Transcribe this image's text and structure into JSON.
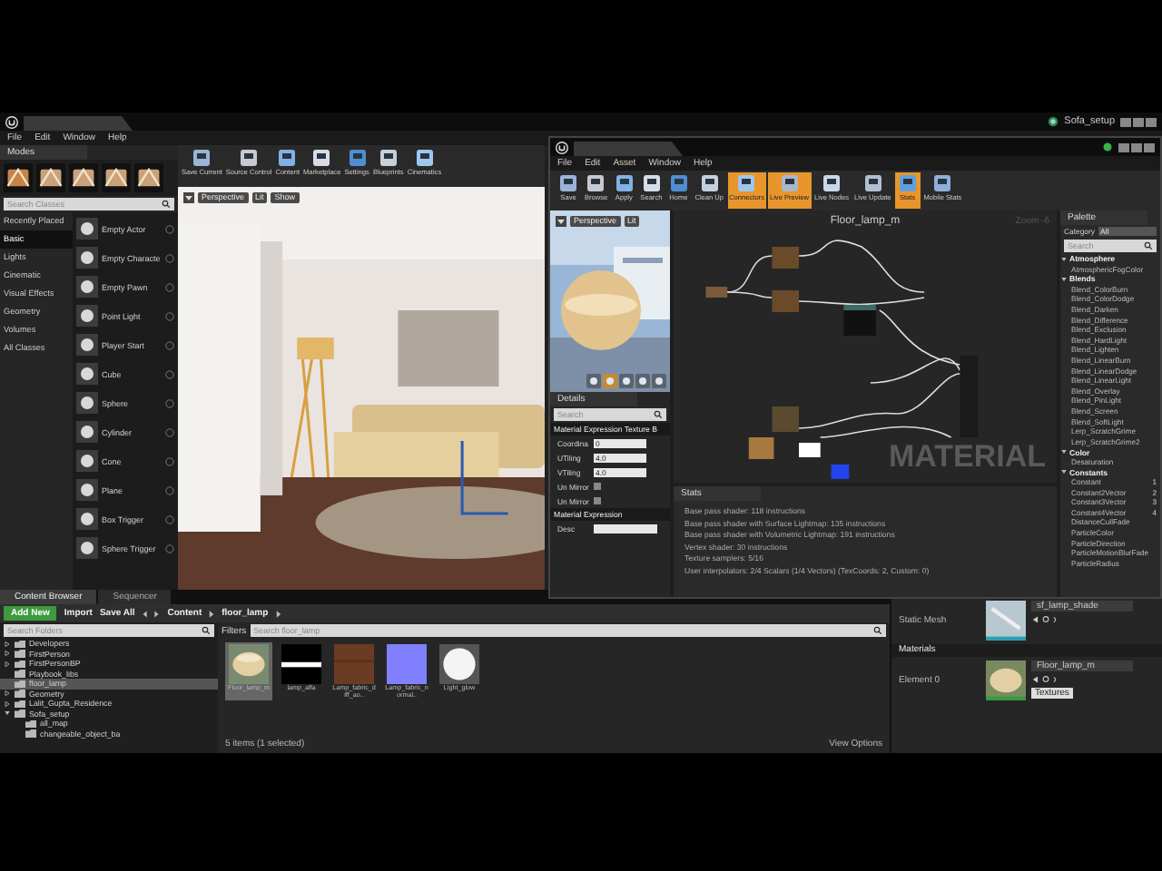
{
  "main_window": {
    "title": "Sofa_setup",
    "menu": [
      "File",
      "Edit",
      "Window",
      "Help"
    ]
  },
  "modes": {
    "title": "Modes",
    "search_placeholder": "Search Classes",
    "categories": [
      {
        "label": "Recently Placed",
        "selected": false
      },
      {
        "label": "Basic",
        "selected": true
      },
      {
        "label": "Lights",
        "selected": false
      },
      {
        "label": "Cinematic",
        "selected": false
      },
      {
        "label": "Visual Effects",
        "selected": false
      },
      {
        "label": "Geometry",
        "selected": false
      },
      {
        "label": "Volumes",
        "selected": false
      },
      {
        "label": "All Classes",
        "selected": false
      }
    ],
    "items": [
      "Empty Actor",
      "Empty Characte",
      "Empty Pawn",
      "Point Light",
      "Player Start",
      "Cube",
      "Sphere",
      "Cylinder",
      "Cone",
      "Plane",
      "Box Trigger",
      "Sphere Trigger"
    ]
  },
  "toolbar": [
    "Save Current",
    "Source Control",
    "Content",
    "Marketplace",
    "Settings",
    "Blueprints",
    "Cinematics"
  ],
  "viewport": {
    "buttons": [
      "Perspective",
      "Lit",
      "Show"
    ]
  },
  "material_editor": {
    "menu": [
      "File",
      "Edit",
      "Asset",
      "Window",
      "Help"
    ],
    "toolbar": [
      {
        "label": "Save",
        "selected": false
      },
      {
        "label": "Browse",
        "selected": false
      },
      {
        "label": "Apply",
        "selected": false
      },
      {
        "label": "Search",
        "selected": false
      },
      {
        "label": "Home",
        "selected": false
      },
      {
        "label": "Clean Up",
        "selected": false
      },
      {
        "label": "Connectors",
        "selected": true
      },
      {
        "label": "Live Preview",
        "selected": true
      },
      {
        "label": "Live Nodes",
        "selected": false
      },
      {
        "label": "Live Update",
        "selected": false
      },
      {
        "label": "Stats",
        "selected": true
      },
      {
        "label": "Mobile Stats",
        "selected": false
      }
    ],
    "preview_buttons": [
      "Perspective",
      "Lit"
    ],
    "graph": {
      "title": "Floor_lamp_m",
      "zoom": "Zoom -6",
      "watermark": "MATERIAL"
    },
    "details": {
      "title": "Details",
      "search_placeholder": "Search",
      "sections": [
        {
          "title": "Material Expression Texture B",
          "props": [
            {
              "kind": "number",
              "label": "Coordina",
              "value": "0"
            },
            {
              "kind": "number",
              "label": "UTiling",
              "value": "4.0"
            },
            {
              "kind": "number",
              "label": "VTiling",
              "value": "4.0"
            },
            {
              "kind": "checkbox",
              "label": "Un Mirror",
              "checked": false
            },
            {
              "kind": "checkbox",
              "label": "Un Mirror",
              "checked": false
            }
          ]
        },
        {
          "title": "Material Expression",
          "props": [
            {
              "kind": "text",
              "label": "Desc"
            }
          ]
        }
      ]
    },
    "stats": {
      "tab": "Stats",
      "lines": [
        "Base pass shader: 118 instructions",
        "Base pass shader with Surface Lightmap: 135 instructions",
        "Base pass shader with Volumetric Lightmap: 191 instructions",
        "Vertex shader: 30 instructions",
        "Texture samplers: 5/16",
        "User interpolators: 2/4 Scalars (1/4 Vectors) (TexCoords: 2, Custom: 0)"
      ]
    },
    "palette": {
      "title": "Palette",
      "category_label": "Category",
      "category": "All",
      "search_placeholder": "Search",
      "groups": [
        {
          "name": "Atmosphere",
          "expanded": true,
          "items": [
            {
              "name": "AtmosphericFogColor"
            }
          ]
        },
        {
          "name": "Blends",
          "expanded": true,
          "items": [
            {
              "name": "Blend_ColorBurn"
            },
            {
              "name": "Blend_ColorDodge"
            },
            {
              "name": "Blend_Darken"
            },
            {
              "name": "Blend_Difference"
            },
            {
              "name": "Blend_Exclusion"
            },
            {
              "name": "Blend_HardLight"
            },
            {
              "name": "Blend_Lighten"
            },
            {
              "name": "Blend_LinearBurn"
            },
            {
              "name": "Blend_LinearDodge"
            },
            {
              "name": "Blend_LinearLight"
            },
            {
              "name": "Blend_Overlay"
            },
            {
              "name": "Blend_PinLight"
            },
            {
              "name": "Blend_Screen"
            },
            {
              "name": "Blend_SoftLight"
            },
            {
              "name": "Lerp_ScratchGrime"
            },
            {
              "name": "Lerp_ScratchGrime2"
            }
          ]
        },
        {
          "name": "Color",
          "expanded": true,
          "items": [
            {
              "name": "Desaturation"
            }
          ]
        },
        {
          "name": "Constants",
          "expanded": true,
          "items": [
            {
              "name": "Constant",
              "hotkey": "1"
            },
            {
              "name": "Constant2Vector",
              "hotkey": "2"
            },
            {
              "name": "Constant3Vector",
              "hotkey": "3"
            },
            {
              "name": "Constant4Vector",
              "hotkey": "4"
            },
            {
              "name": "DistanceCullFade"
            },
            {
              "name": "ParticleColor"
            },
            {
              "name": "ParticleDirection"
            },
            {
              "name": "ParticleMotionBlurFade"
            },
            {
              "name": "ParticleRadius"
            }
          ]
        }
      ]
    }
  },
  "content_browser": {
    "tabs": [
      {
        "label": "Content Browser",
        "selected": true
      },
      {
        "label": "Sequencer",
        "selected": false
      }
    ],
    "add_new": "Add New",
    "import": "Import",
    "save_all": "Save All",
    "path": [
      "Content",
      "floor_lamp"
    ],
    "folder_search_placeholder": "Search Folders",
    "folders": [
      {
        "name": "Developers",
        "expanded": false,
        "selected": false
      },
      {
        "name": "FirstPerson",
        "expanded": false,
        "selected": false
      },
      {
        "name": "FirstPersonBP",
        "expanded": false,
        "selected": false
      },
      {
        "name": "Playbook_libs",
        "selected": false
      },
      {
        "name": "floor_lamp",
        "selected": true
      },
      {
        "name": "Geometry",
        "expanded": false,
        "selected": false
      },
      {
        "name": "Lalit_Gupta_Residence",
        "expanded": false,
        "selected": false
      },
      {
        "name": "Sofa_setup",
        "expanded": true,
        "selected": false,
        "children": [
          {
            "name": "all_map",
            "selected": false
          },
          {
            "name": "changeable_object_ba",
            "selected": false
          }
        ]
      }
    ],
    "filters": "Filters",
    "search_placeholder": "Search floor_lamp",
    "assets": [
      {
        "name": "Floor_lamp_m",
        "selected": true
      },
      {
        "name": "lamp_alfa",
        "selected": false
      },
      {
        "name": "Lamp_fabric_diff_ao..",
        "selected": false
      },
      {
        "name": "Lamp_fabric_normal..",
        "selected": false
      },
      {
        "name": "Light_glow",
        "selected": false
      }
    ],
    "count": "5 items (1 selected)",
    "view_options": "View Options"
  },
  "details": {
    "static_mesh_label": "Static Mesh",
    "static_mesh": "sf_lamp_shade",
    "materials_header": "Materials",
    "element_label": "Element 0",
    "material": "Floor_lamp_m",
    "textures_button": "Textures"
  }
}
